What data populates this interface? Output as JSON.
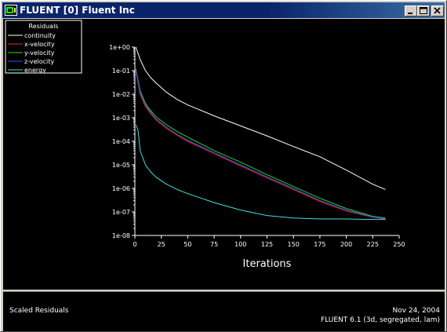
{
  "window": {
    "title": "FLUENT [0] Fluent Inc"
  },
  "controls": {
    "minimize_icon": "minimize-icon",
    "maximize_icon": "maximize-icon",
    "close_icon": "close-icon"
  },
  "status": {
    "left_label": "Scaled Residuals",
    "date": "Nov 24, 2004",
    "version": "FLUENT 6.1 (3d, segregated, lam)"
  },
  "chart_data": {
    "type": "line",
    "xlabel": "Iterations",
    "ylabel": "",
    "log_y": true,
    "xlim": [
      0,
      250
    ],
    "ylim": [
      1e-08,
      1
    ],
    "x_ticks": [
      "0",
      "25",
      "50",
      "75",
      "100",
      "125",
      "150",
      "175",
      "200",
      "225",
      "250"
    ],
    "y_ticks": [
      "1e-08",
      "1e-07",
      "1e-06",
      "1e-05",
      "1e-04",
      "1e-03",
      "1e-02",
      "1e-01",
      "1e+00"
    ],
    "legend_title": "Residuals",
    "legend_position": "top-left",
    "background": "#000000",
    "series": [
      {
        "name": "continuity",
        "color": "#ffffff",
        "x": [
          1,
          5,
          10,
          15,
          20,
          30,
          40,
          50,
          75,
          100,
          125,
          150,
          175,
          200,
          225,
          237
        ],
        "y": [
          1,
          0.3,
          0.1,
          0.05,
          0.03,
          0.012,
          0.006,
          0.0035,
          0.0012,
          0.00045,
          0.00017,
          6e-05,
          2.2e-05,
          6e-06,
          1.5e-06,
          9e-07
        ]
      },
      {
        "name": "x-velocity",
        "color": "#ff2020",
        "x": [
          1,
          5,
          10,
          15,
          20,
          30,
          40,
          50,
          75,
          100,
          125,
          150,
          175,
          200,
          225,
          237
        ],
        "y": [
          0.1,
          0.01,
          0.003,
          0.0015,
          0.0008,
          0.00035,
          0.00018,
          0.0001,
          3e-05,
          9e-06,
          2.8e-06,
          9e-07,
          2.8e-07,
          1.1e-07,
          6e-08,
          5e-08
        ]
      },
      {
        "name": "y-velocity",
        "color": "#20e020",
        "x": [
          1,
          5,
          10,
          15,
          20,
          30,
          40,
          50,
          75,
          100,
          125,
          150,
          175,
          200,
          225,
          237
        ],
        "y": [
          0.12,
          0.014,
          0.004,
          0.002,
          0.0011,
          0.0005,
          0.00026,
          0.00015,
          4e-05,
          1.3e-05,
          3.8e-06,
          1.2e-06,
          3.8e-07,
          1.4e-07,
          6.5e-08,
          5.5e-08
        ]
      },
      {
        "name": "z-velocity",
        "color": "#3050ff",
        "x": [
          1,
          5,
          10,
          15,
          20,
          30,
          40,
          50,
          75,
          100,
          125,
          150,
          175,
          200,
          225,
          237
        ],
        "y": [
          0.11,
          0.012,
          0.0035,
          0.0017,
          0.0009,
          0.0004,
          0.0002,
          0.00011,
          3.3e-05,
          1e-05,
          3.1e-06,
          1e-06,
          3.1e-07,
          1.2e-07,
          6.2e-08,
          5.2e-08
        ]
      },
      {
        "name": "energy",
        "color": "#40e0e0",
        "x": [
          1,
          3,
          5,
          10,
          15,
          20,
          30,
          40,
          50,
          75,
          100,
          125,
          150,
          175,
          200,
          225,
          237
        ],
        "y": [
          0.0005,
          0.0003,
          4e-05,
          1e-05,
          5e-06,
          3e-06,
          1.5e-06,
          9e-07,
          6e-07,
          2.5e-07,
          1.2e-07,
          7e-08,
          5.5e-08,
          5e-08,
          5e-08,
          4.8e-08,
          4.8e-08
        ]
      }
    ]
  }
}
